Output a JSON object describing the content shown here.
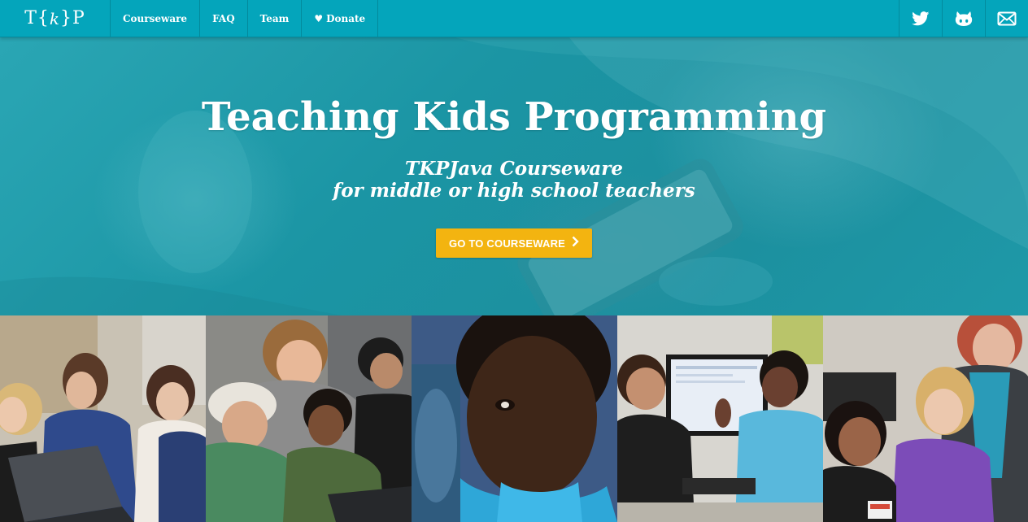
{
  "nav": {
    "logo": {
      "left": "T",
      "brace_open": "{",
      "k": "k",
      "brace_close": "}",
      "right": "P"
    },
    "items": [
      {
        "label": "Courseware"
      },
      {
        "label": "FAQ"
      },
      {
        "label": "Team"
      },
      {
        "label": "Donate",
        "icon": "heart-icon"
      }
    ],
    "social": [
      {
        "icon": "twitter-icon"
      },
      {
        "icon": "github-icon"
      },
      {
        "icon": "mail-icon"
      }
    ]
  },
  "hero": {
    "title": "Teaching Kids Programming",
    "subtitle_line1": "TKPJava Courseware",
    "subtitle_line2": "for middle or high school teachers",
    "cta_label": "GO TO COURSEWARE",
    "cta_icon": "chevron-right-icon"
  },
  "photos": [
    {
      "name": "photo-students-laptop"
    },
    {
      "name": "photo-boys-coding"
    },
    {
      "name": "photo-boy-portrait"
    },
    {
      "name": "photo-kids-computer"
    },
    {
      "name": "photo-girls-teacher"
    }
  ],
  "colors": {
    "nav_bg": "#04a5bb",
    "hero_bg": "#1c95a4",
    "cta_bg": "#f3b410",
    "text": "#ffffff"
  }
}
